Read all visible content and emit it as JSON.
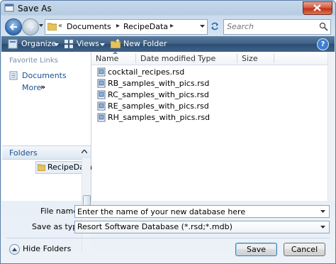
{
  "window": {
    "title": "Save As",
    "close_icon": "close-icon"
  },
  "address": {
    "crumbs": [
      "Documents",
      "RecipeData"
    ],
    "overflow_marker": "«"
  },
  "search": {
    "placeholder": "Search"
  },
  "toolbar": {
    "organize_label": "Organize",
    "views_label": "Views",
    "new_folder_label": "New Folder",
    "help_label": "?"
  },
  "sidebar": {
    "favorite_links_title": "Favorite Links",
    "links": [
      "Documents"
    ],
    "more_label": "More",
    "more_chevron": "»",
    "folders_label": "Folders",
    "tree_selected": "RecipeData"
  },
  "file_list": {
    "columns": [
      "Name",
      "Date modified",
      "Type",
      "Size"
    ],
    "files": [
      "cocktail_recipes.rsd",
      "RB_samples_with_pics.rsd",
      "RC_samples_with_pics.rsd",
      "RE_samples_with_pics.rsd",
      "RH_samples_with_pics.rsd"
    ]
  },
  "form": {
    "file_name_label": "File name:",
    "file_name_value": "Enter the name of your new database here",
    "save_as_type_label": "Save as type:",
    "save_as_type_value": "Resort Software Database (*.rsd;*.mdb)"
  },
  "footer": {
    "hide_folders_label": "Hide Folders",
    "save_label": "Save",
    "cancel_label": "Cancel"
  },
  "colors": {
    "toolbar": "#3c5f83",
    "link_blue": "#1a4e93",
    "close_red": "#c2321a"
  }
}
